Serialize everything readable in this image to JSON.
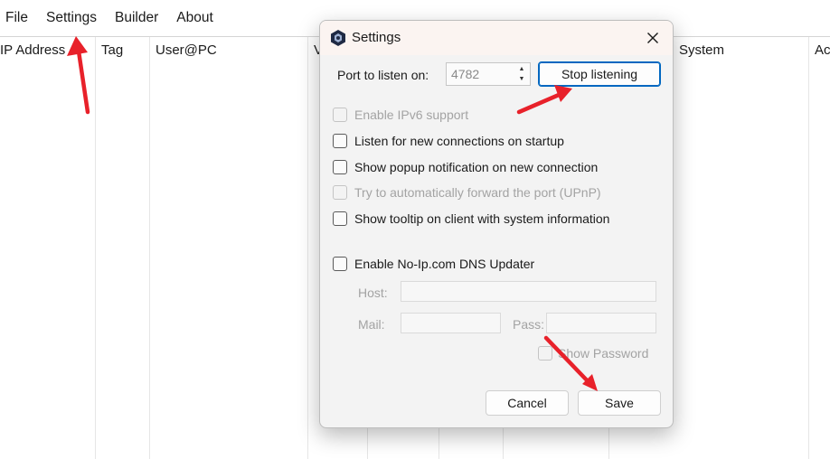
{
  "menu": {
    "file": "File",
    "settings": "Settings",
    "builder": "Builder",
    "about": "About"
  },
  "list": {
    "columns": [
      "IP Address",
      "Tag",
      "User@PC",
      "V",
      "System",
      "Ac"
    ]
  },
  "dialog": {
    "title": "Settings",
    "port_label": "Port to listen on:",
    "port_value": "4782",
    "stop_button": "Stop listening",
    "options": {
      "ipv6": "Enable IPv6 support",
      "startup": "Listen for new connections on startup",
      "popup": "Show popup notification on new connection",
      "upnp": "Try to automatically forward the port (UPnP)",
      "tooltip": "Show tooltip on client with system information",
      "noip": "Enable No-Ip.com DNS Updater"
    },
    "host_label": "Host:",
    "mail_label": "Mail:",
    "pass_label": "Pass:",
    "show_password": "Show Password",
    "cancel_button": "Cancel",
    "save_button": "Save"
  },
  "colors": {
    "accent": "#0067c0",
    "annotation_arrow": "#e8212a"
  },
  "icons": [
    "app-logo-icon",
    "close-icon",
    "spin-up-icon",
    "spin-down-icon",
    "arrow-annotation-icon"
  ]
}
